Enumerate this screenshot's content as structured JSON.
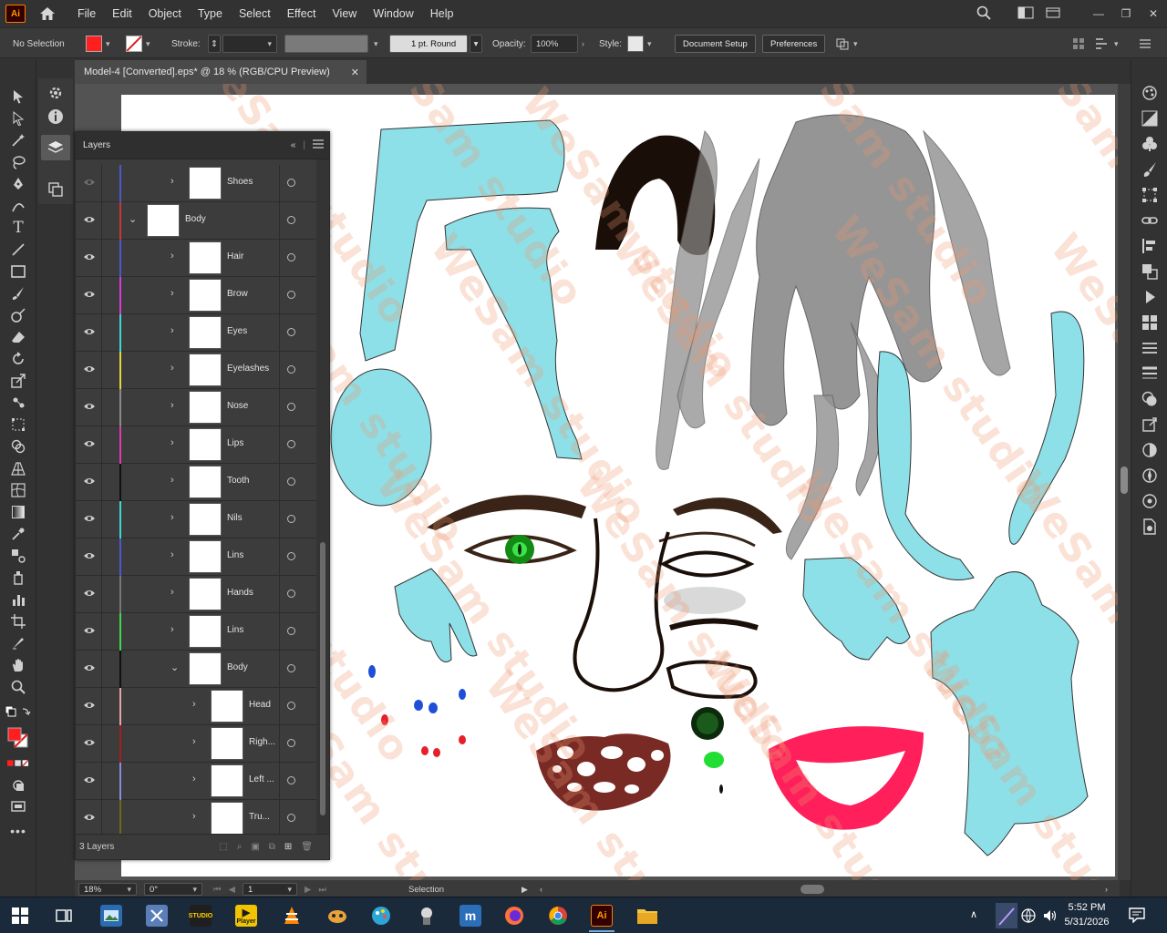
{
  "app": {
    "logo_text": "Ai"
  },
  "menu": [
    "File",
    "Edit",
    "Object",
    "Type",
    "Select",
    "Effect",
    "View",
    "Window",
    "Help"
  ],
  "controlbar": {
    "selection_status": "No Selection",
    "stroke_label": "Stroke:",
    "brush_value": "1 pt. Round",
    "opacity_label": "Opacity:",
    "opacity_value": "100%",
    "style_label": "Style:",
    "document_setup": "Document Setup",
    "preferences": "Preferences",
    "fill_color": "#ff1f1f"
  },
  "document": {
    "tab_title": "Model-4 [Converted].eps* @ 18 % (RGB/CPU Preview)"
  },
  "layers_panel": {
    "title": "Layers",
    "footer_count": "3 Layers",
    "rows": [
      {
        "name": "Shoes",
        "color": "#4a59c9",
        "expanded": false,
        "indent": 1
      },
      {
        "name": "Body",
        "color": "#c93636",
        "expanded": true,
        "indent": 0
      },
      {
        "name": "Hair",
        "color": "#4a59c9",
        "expanded": false,
        "indent": 1
      },
      {
        "name": "Brow",
        "color": "#d63bd6",
        "expanded": false,
        "indent": 1
      },
      {
        "name": "Eyes",
        "color": "#3ad8d8",
        "expanded": false,
        "indent": 1
      },
      {
        "name": "Eyelashes",
        "color": "#e5d63a",
        "expanded": false,
        "indent": 1
      },
      {
        "name": "Nose",
        "color": "#8a8a8a",
        "expanded": false,
        "indent": 1
      },
      {
        "name": "Lips",
        "color": "#e03ab0",
        "expanded": false,
        "indent": 1
      },
      {
        "name": "Tooth",
        "color": "#111111",
        "expanded": false,
        "indent": 1
      },
      {
        "name": "Nils",
        "color": "#3ad8d8",
        "expanded": false,
        "indent": 1
      },
      {
        "name": "Lins",
        "color": "#4a59c9",
        "expanded": false,
        "indent": 1
      },
      {
        "name": "Hands",
        "color": "#777777",
        "expanded": false,
        "indent": 1
      },
      {
        "name": "Lins",
        "color": "#3ed84b",
        "expanded": false,
        "indent": 1
      },
      {
        "name": "Body",
        "color": "#111111",
        "expanded": true,
        "indent": 1
      },
      {
        "name": "Head",
        "color": "#e8a3a3",
        "expanded": false,
        "indent": 2
      },
      {
        "name": "Righ...",
        "color": "#a31f1f",
        "expanded": false,
        "indent": 2
      },
      {
        "name": "Left ...",
        "color": "#8a8ad8",
        "expanded": false,
        "indent": 2
      },
      {
        "name": "Tru...",
        "color": "#6a6a1f",
        "expanded": false,
        "indent": 2
      }
    ]
  },
  "statusbar": {
    "zoom": "18%",
    "rotation": "0°",
    "artboard_number": "1",
    "tool": "Selection"
  },
  "watermark": "WeSam studio",
  "clock": {
    "time": "5:52 PM",
    "date": "5/31/2026"
  },
  "taskbar": {
    "icons": [
      "windows-start",
      "task-view",
      "photo-viewer",
      "snipping-tool",
      "studio-app",
      "player-app",
      "vlc",
      "game-app",
      "paint-app",
      "guard-app",
      "m-app",
      "firefox",
      "chrome",
      "illustrator",
      "file-explorer"
    ],
    "player_label": "Player",
    "studio_label": "STUDIO"
  }
}
